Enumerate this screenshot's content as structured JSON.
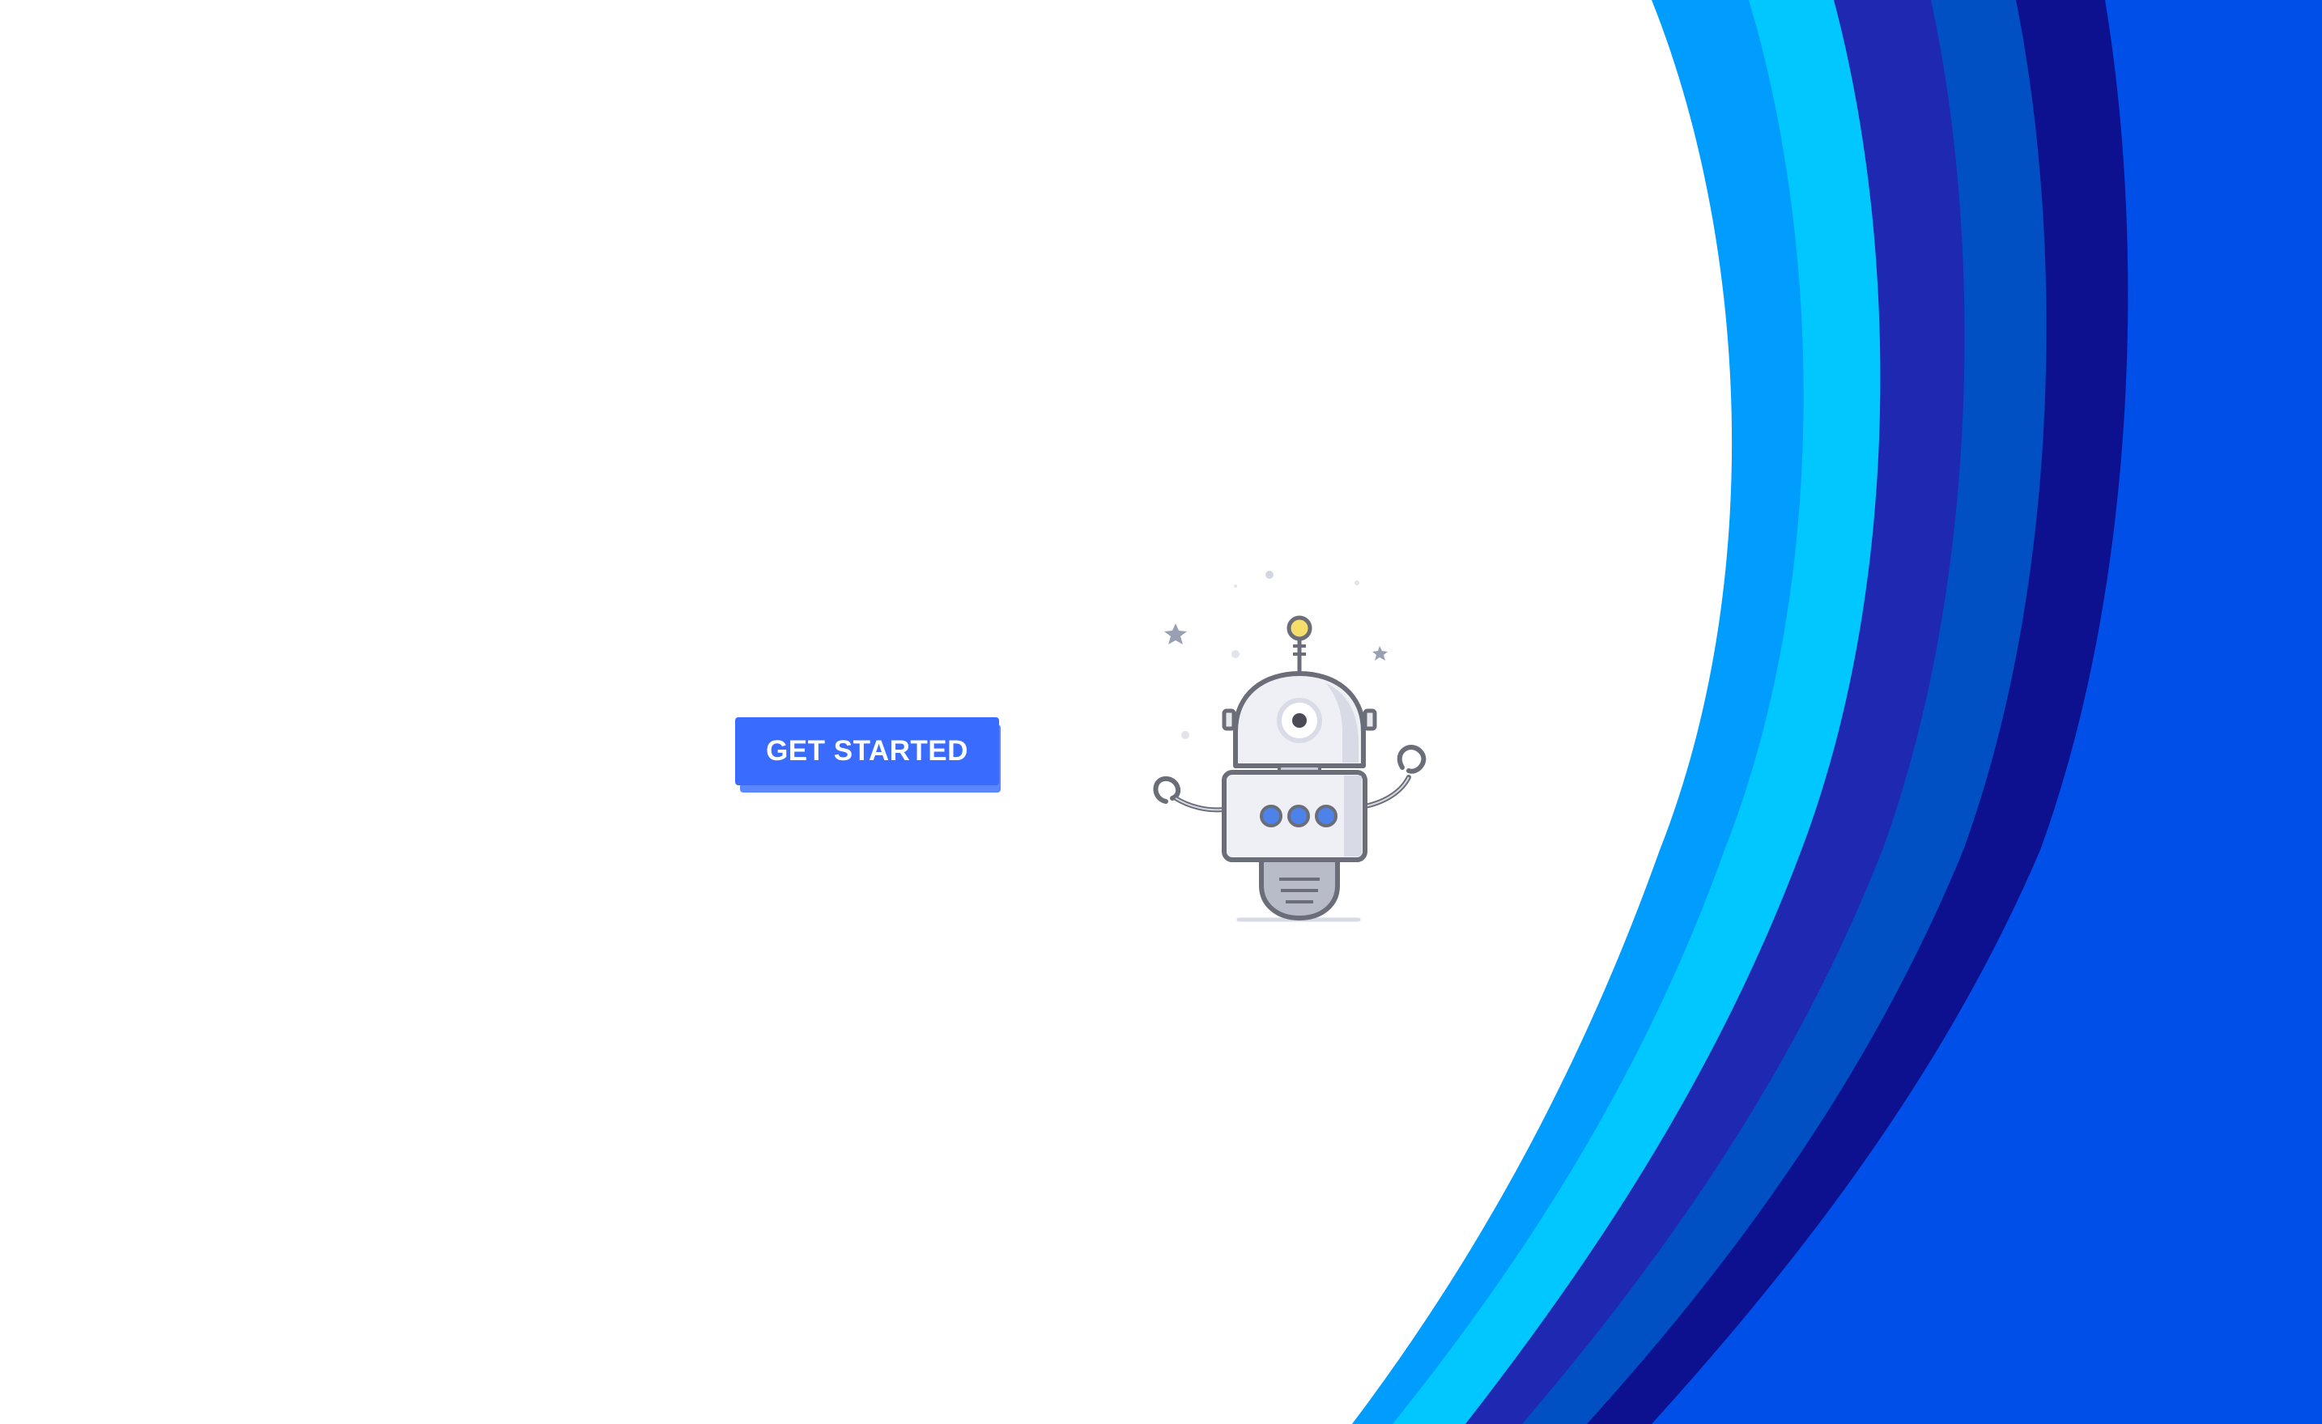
{
  "hero": {
    "cta_label": "GET STARTED",
    "illustration": "robot-mascot"
  },
  "theme": {
    "button_color": "#3a6bff",
    "button_shadow_color": "#5a86ff",
    "wave_colors": [
      "#009dff",
      "#00c8ff",
      "#1f28b0",
      "#0050c4",
      "#0d118f",
      "#004fe8"
    ]
  }
}
